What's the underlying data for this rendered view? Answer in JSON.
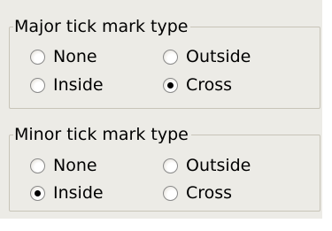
{
  "major": {
    "title": "Major tick mark type",
    "options": [
      {
        "label": "None",
        "checked": false
      },
      {
        "label": "Outside",
        "checked": false
      },
      {
        "label": "Inside",
        "checked": false
      },
      {
        "label": "Cross",
        "checked": true
      }
    ]
  },
  "minor": {
    "title": "Minor tick mark type",
    "options": [
      {
        "label": "None",
        "checked": false
      },
      {
        "label": "Outside",
        "checked": false
      },
      {
        "label": "Inside",
        "checked": true
      },
      {
        "label": "Cross",
        "checked": false
      }
    ]
  }
}
